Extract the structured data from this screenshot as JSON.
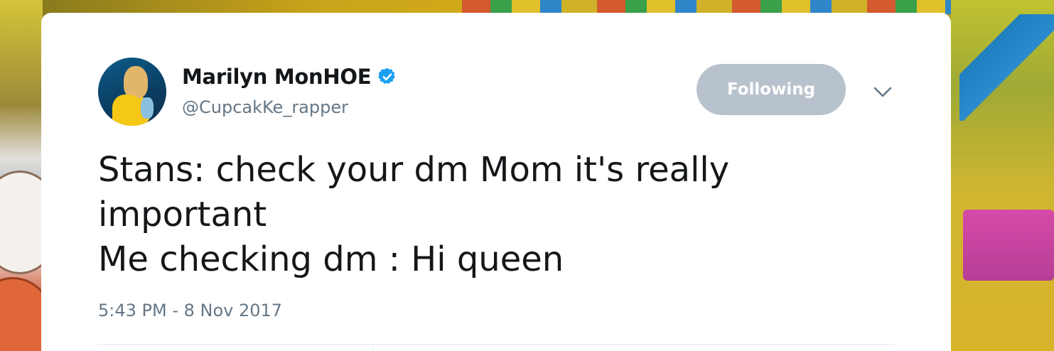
{
  "tweet": {
    "display_name": "Marilyn MonHOE",
    "verified": true,
    "verified_icon": "verified-badge-icon",
    "handle": "@CupcakKe_rapper",
    "follow_button_label": "Following",
    "menu_icon": "chevron-down-icon",
    "text_lines": [
      "Stans: check your dm Mom it's really",
      "important",
      "Me checking dm : Hi queen"
    ],
    "timestamp": "5:43 PM - 8 Nov 2017"
  },
  "colors": {
    "verified_blue": "#1da1f2",
    "following_button_bg": "#b8c2cc",
    "text_primary": "#14171a",
    "text_secondary": "#657786"
  }
}
